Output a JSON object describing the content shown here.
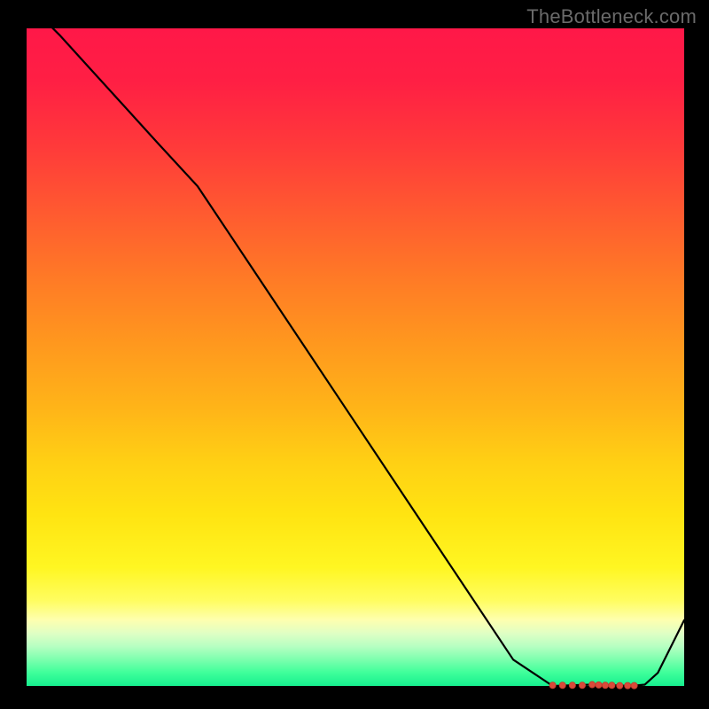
{
  "watermark": "TheBottleneck.com",
  "colors": {
    "line": "#000000",
    "marker_fill": "#d94a3a",
    "marker_stroke": "#c23a2b",
    "gradient_top": "#ff1848",
    "gradient_bottom": "#16ef8f"
  },
  "chart_data": {
    "type": "line",
    "title": "",
    "xlabel": "",
    "ylabel": "",
    "xlim": [
      0,
      100
    ],
    "ylim": [
      0,
      100
    ],
    "grid": false,
    "legend": false,
    "series": [
      {
        "name": "curve",
        "x": [
          0,
          5,
          10,
          15,
          20,
          26,
          34,
          42,
          50,
          58,
          66,
          74,
          80,
          83,
          86,
          89,
          92,
          94,
          96,
          100
        ],
        "y": [
          104,
          99,
          93.5,
          88,
          82.5,
          76,
          64,
          52,
          40,
          28,
          16,
          4,
          0,
          0.1,
          0.2,
          0.1,
          0.0,
          0.2,
          2,
          10
        ]
      }
    ],
    "markers": {
      "series": "curve",
      "points_x": [
        80,
        81.5,
        83,
        84.5,
        86,
        87,
        88,
        89,
        90.2,
        91.4,
        92.4
      ],
      "points_y": [
        0.1,
        0.1,
        0.1,
        0.1,
        0.2,
        0.15,
        0.1,
        0.1,
        0.05,
        0.05,
        0.05
      ],
      "radius": 3.6
    }
  }
}
